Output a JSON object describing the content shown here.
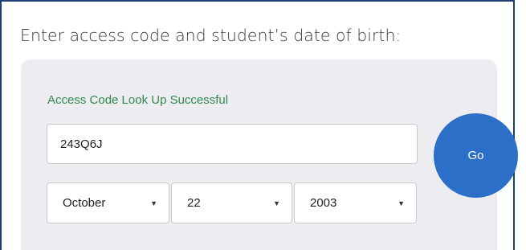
{
  "form": {
    "heading": "Enter access code and student’s date of birth:",
    "status_message": "Access Code Look Up Successful",
    "access_code_value": "243Q6J",
    "go_label": "Go",
    "dob": {
      "month": "October",
      "day": "22",
      "year": "2003"
    }
  },
  "icons": {
    "select_caret": "caret-down-icon"
  },
  "colors": {
    "go_button": "#2c6fc8",
    "success_text": "#2f8a4c",
    "panel_bg": "#ededf1",
    "frame_border": "#1d3f73"
  }
}
